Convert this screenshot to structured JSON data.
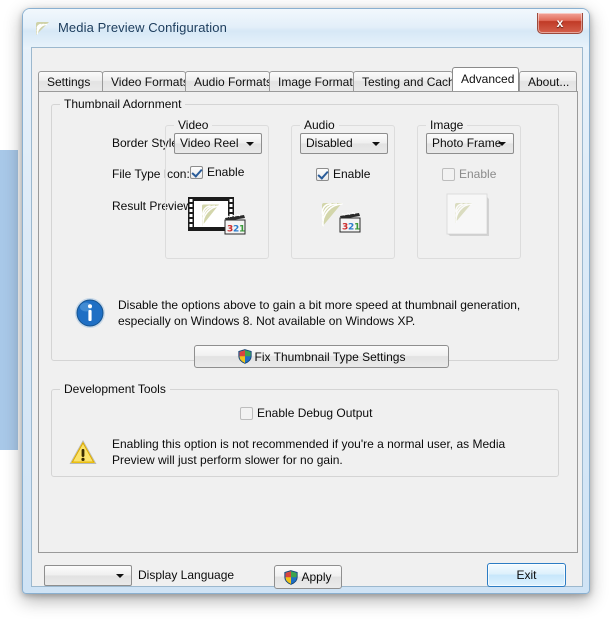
{
  "window": {
    "title": "Media Preview Configuration",
    "icon": "app-logo-icon",
    "close_label": "x"
  },
  "tabs": [
    {
      "label": "Settings",
      "selected": false
    },
    {
      "label": "Video Formats",
      "selected": false
    },
    {
      "label": "Audio Formats",
      "selected": false
    },
    {
      "label": "Image Formats",
      "selected": false
    },
    {
      "label": "Testing and Cache",
      "selected": false
    },
    {
      "label": "Advanced",
      "selected": true
    },
    {
      "label": "About...",
      "selected": false
    }
  ],
  "advanced": {
    "adornment": {
      "title": "Thumbnail Adornment",
      "row_labels": {
        "border_style": "Border Style:",
        "file_type_icon": "File Type Icon:",
        "result_preview": "Result Preview:"
      },
      "columns": [
        {
          "title": "Video",
          "border_style_value": "Video Reel",
          "enable_label": "Enable",
          "enable_checked": true,
          "enable_disabled": false,
          "preview_icon": "video-reel-thumbnail-icon"
        },
        {
          "title": "Audio",
          "border_style_value": "Disabled",
          "enable_label": "Enable",
          "enable_checked": true,
          "enable_disabled": false,
          "preview_icon": "audio-plain-thumbnail-icon"
        },
        {
          "title": "Image",
          "border_style_value": "Photo Frame",
          "enable_label": "Enable",
          "enable_checked": false,
          "enable_disabled": true,
          "preview_icon": "photo-frame-thumbnail-icon"
        }
      ]
    },
    "info": {
      "icon": "information-icon",
      "text": "Disable the options above to gain a bit more speed at thumbnail generation, especially on Windows 8. Not available on Windows XP."
    },
    "fix_button": {
      "label": "Fix Thumbnail Type Settings",
      "icon": "uac-shield-icon"
    },
    "devtools": {
      "title": "Development Tools",
      "debug_checkbox": {
        "label": "Enable Debug Output",
        "checked": false
      },
      "warning": {
        "icon": "warning-triangle-icon",
        "text": "Enabling this option is not recommended if you're a normal user, as Media Preview will just perform slower for no gain."
      }
    },
    "apply_button": {
      "label": "Apply",
      "icon": "uac-shield-icon"
    }
  },
  "statusbar": {
    "language_combo_value": "",
    "language_label": "Display Language",
    "exit_button": "Exit"
  },
  "colors": {
    "accent_blue": "#2b7cc4",
    "close_red": "#c03a26",
    "dialog_face": "#f0f0f0",
    "logo_olive": "#b9bc8a"
  }
}
